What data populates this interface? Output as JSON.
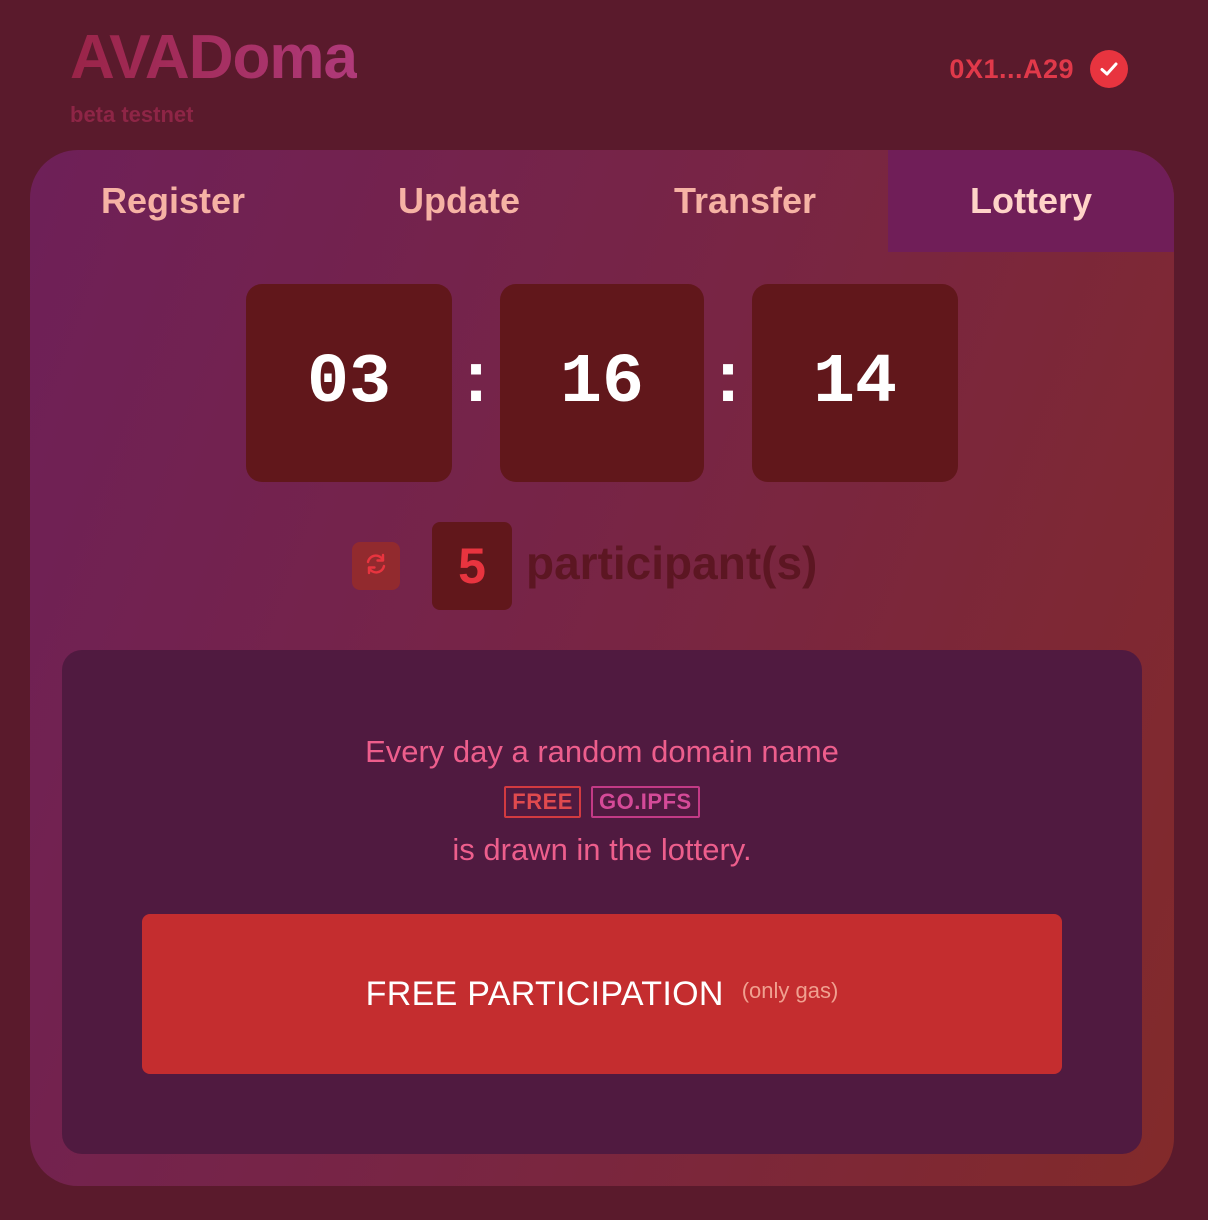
{
  "brand": {
    "logo_text": "AVADoma",
    "subtitle": "beta testnet"
  },
  "wallet": {
    "address": "0X1...A29",
    "status_icon": "check-circle-icon",
    "accent_color": "#e8343f"
  },
  "tabs": [
    {
      "label": "Register",
      "active": false
    },
    {
      "label": "Update",
      "active": false
    },
    {
      "label": "Transfer",
      "active": false
    },
    {
      "label": "Lottery",
      "active": true
    }
  ],
  "countdown": {
    "hours": "03",
    "minutes": "16",
    "seconds": "14",
    "separator": ":"
  },
  "participants": {
    "refresh_icon": "refresh-icon",
    "count": "5",
    "label": "participant(s)"
  },
  "lottery_info": {
    "line1": "Every day a random domain name",
    "tag_free": "FREE",
    "tag_domain": "GO.IPFS",
    "line2": "is drawn in the lottery."
  },
  "cta": {
    "label": "FREE PARTICIPATION",
    "note": "(only gas)",
    "color": "#c42d2f"
  }
}
